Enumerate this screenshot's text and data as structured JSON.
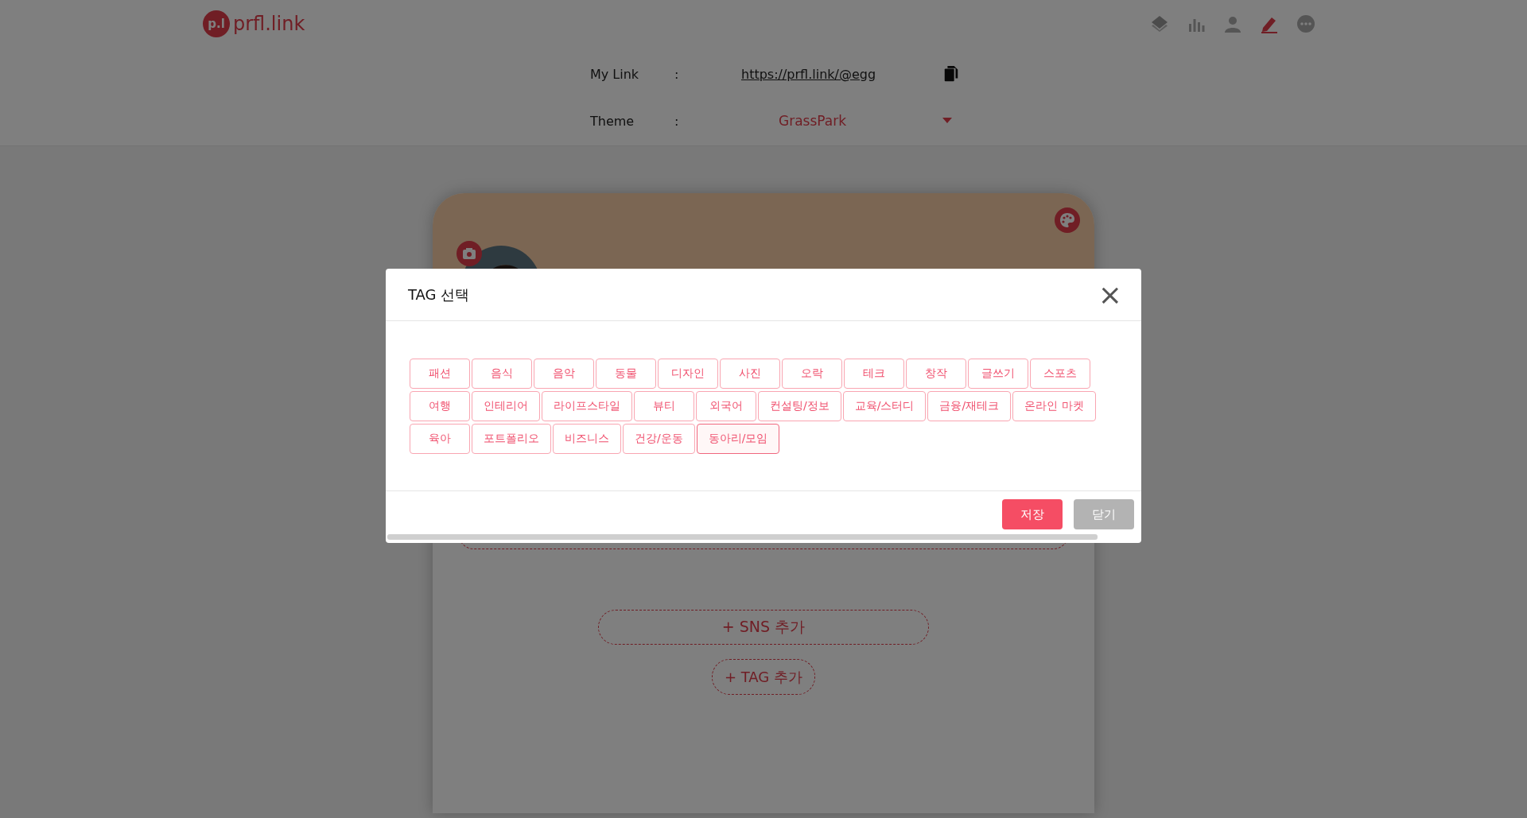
{
  "header": {
    "logo_mark": "p.l",
    "logo_text": "prfl.link"
  },
  "settings": {
    "link_label": "My Link",
    "link_colon": ":",
    "link_url": "https://prfl.link/@egg",
    "theme_label": "Theme",
    "theme_colon": ":",
    "theme_value": "GrassPark"
  },
  "profile": {
    "sns_button": "+ SNS 추가",
    "tag_button": "+ TAG 추가"
  },
  "modal": {
    "title": "TAG 선택",
    "close": "×",
    "tags": [
      {
        "label": "패션",
        "selected": false
      },
      {
        "label": "음식",
        "selected": false
      },
      {
        "label": "음악",
        "selected": false
      },
      {
        "label": "동물",
        "selected": false
      },
      {
        "label": "디자인",
        "selected": false
      },
      {
        "label": "사진",
        "selected": false
      },
      {
        "label": "오락",
        "selected": false
      },
      {
        "label": "테크",
        "selected": false
      },
      {
        "label": "창작",
        "selected": false
      },
      {
        "label": "글쓰기",
        "selected": false
      },
      {
        "label": "스포츠",
        "selected": false
      },
      {
        "label": "여행",
        "selected": false
      },
      {
        "label": "인테리어",
        "selected": false
      },
      {
        "label": "라이프스타일",
        "selected": false
      },
      {
        "label": "뷰티",
        "selected": false
      },
      {
        "label": "외국어",
        "selected": false
      },
      {
        "label": "컨설팅/정보",
        "selected": false
      },
      {
        "label": "교육/스터디",
        "selected": false
      },
      {
        "label": "금융/재테크",
        "selected": false
      },
      {
        "label": "온라인 마켓",
        "selected": false
      },
      {
        "label": "육아",
        "selected": false
      },
      {
        "label": "포트폴리오",
        "selected": false
      },
      {
        "label": "비즈니스",
        "selected": false
      },
      {
        "label": "건강/운동",
        "selected": false
      },
      {
        "label": "동아리/모임",
        "selected": true
      }
    ],
    "buttons": [
      {
        "label": "저장",
        "kind": "primary"
      },
      {
        "label": "닫기",
        "kind": "secondary"
      }
    ]
  }
}
